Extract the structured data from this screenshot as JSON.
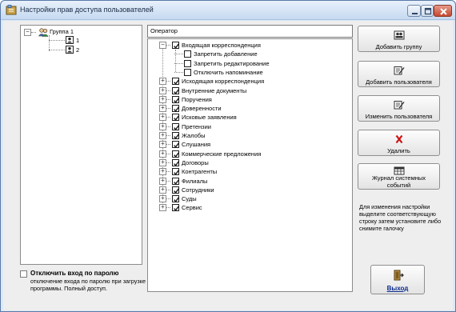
{
  "window": {
    "title": "Настройки прав доступа пользователей",
    "colors": {
      "accent": "#c6daf1",
      "close": "#c4482f",
      "delete_icon": "#cc1111"
    }
  },
  "left_tree": {
    "group": "Группа 1",
    "users": [
      "1",
      "2"
    ]
  },
  "operator_field": {
    "value": "Оператор"
  },
  "rights_tree": {
    "root": "Входящая корреспонденция",
    "root_children": [
      "Запретить добавление",
      "Запретить редактирование",
      "Отключить напоминание"
    ],
    "items": [
      "Исходящая корреспонденция",
      "Внутренние документы",
      "Поручения",
      "Доверенности",
      "Исковые заявления",
      "Претензии",
      "Жалобы",
      "Слушания",
      "Коммерческие предложения",
      "Договоры",
      "Контрагенты",
      "Филиалы",
      "Сотрудники",
      "Суды",
      "Сервис"
    ]
  },
  "buttons": {
    "add_group": "Добавить группу",
    "add_user": "Добавить пользователя",
    "edit_user": "Изменить пользователя",
    "delete": "Удалить",
    "journal_line1": "Журнал системных",
    "journal_line2": "событий",
    "exit": "Выход"
  },
  "hint": "Для изменения настройки выделите соответствующую строку затем установите либо снимите галочку",
  "password": {
    "title": "Отключить вход по паролю",
    "description": "отключение входа по паролю при загрузке программы. Полный доступ."
  }
}
